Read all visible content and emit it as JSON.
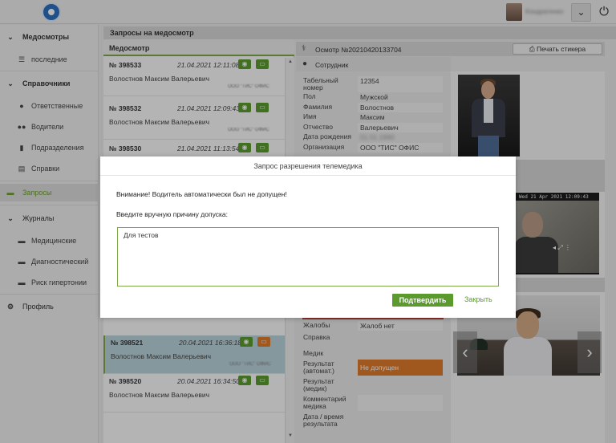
{
  "topbar": {
    "user_name": "Кондратенко",
    "dropdown_icon": "chevron-down-icon",
    "power_icon": "power-icon"
  },
  "sidebar": {
    "sections": [
      {
        "label": "Медосмотры",
        "items": [
          {
            "label": "последние"
          }
        ]
      },
      {
        "label": "Справочники",
        "items": [
          {
            "label": "Ответственные"
          },
          {
            "label": "Водители"
          },
          {
            "label": "Подразделения"
          },
          {
            "label": "Справки"
          }
        ]
      }
    ],
    "active_item": "Запросы",
    "journals": {
      "label": "Журналы",
      "items": [
        {
          "label": "Медицинские"
        },
        {
          "label": "Диагностический"
        },
        {
          "label": "Риск гипертонии"
        }
      ]
    },
    "profile": "Профиль"
  },
  "content": {
    "title": "Запросы на медосмотр",
    "list_header": "Медосмотр"
  },
  "records": [
    {
      "num": "№ 398533",
      "date": "21.04.2021 12:11:08",
      "name": "Волостнов Максим Валерьевич",
      "org": "ООО \"ТИС\" ОФИС",
      "status": "green"
    },
    {
      "num": "№ 398532",
      "date": "21.04.2021 12:09:43",
      "name": "Волостнов Максим Валерьевич",
      "org": "ООО \"ТИС\" ОФИС",
      "status": "green"
    },
    {
      "num": "№ 398530",
      "date": "21.04.2021 11:13:54",
      "name": "",
      "org": "",
      "status": "green"
    },
    {
      "num": "№ 398521",
      "date": "20.04.2021 16:36:18",
      "name": "Волостнов Максим Валерьевич",
      "org": "ООО \"ТИС\" ОФИС",
      "status": "orange"
    },
    {
      "num": "№ 398520",
      "date": "20.04.2021 16:34:50",
      "name": "Волостнов Максим Валерьевич",
      "org": "ООО \"ТИС\" ОФИС",
      "status": "green"
    }
  ],
  "detail": {
    "osmotr_title": "Осмотр №20210420133704",
    "print_button": "Печать стикера",
    "employee_title": "Сотрудник",
    "fields": [
      {
        "k": "Табельный номер",
        "v": "12354"
      },
      {
        "k": "Пол",
        "v": "Мужской"
      },
      {
        "k": "Фамилия",
        "v": "Волостнов"
      },
      {
        "k": "Имя",
        "v": "Максим"
      },
      {
        "k": "Отчество",
        "v": "Валерьевич"
      },
      {
        "k": "Дата рождения",
        "v": "01.01.1990"
      },
      {
        "k": "Организация",
        "v": "ООО \"ТИС\" ОФИС"
      }
    ],
    "lower_fields": [
      {
        "k": "Жалобы",
        "v": "Жалоб нет"
      },
      {
        "k": "Справка",
        "v": ""
      },
      {
        "k": "Медик",
        "v": ""
      },
      {
        "k": "Результат (автомат.)",
        "v": "Не допущен"
      },
      {
        "k": "Результат (медик)",
        "v": ""
      },
      {
        "k": "Комментарий медика",
        "v": ""
      },
      {
        "k": "Дата / время результата",
        "v": ""
      }
    ],
    "video_caption": "Wed 21 Apr 2021 12:09:43"
  },
  "modal": {
    "title": "Запрос разрешения телемедика",
    "warning": "Внимание! Водитель автоматически был не допущен!",
    "prompt": "Введите вручную причину допуска:",
    "textarea_value": "Для тестов",
    "confirm_label": "Подтвердить",
    "close_label": "Закрыть"
  },
  "colors": {
    "accent_green": "#5b9b2e",
    "warning_orange": "#e07a2a"
  }
}
